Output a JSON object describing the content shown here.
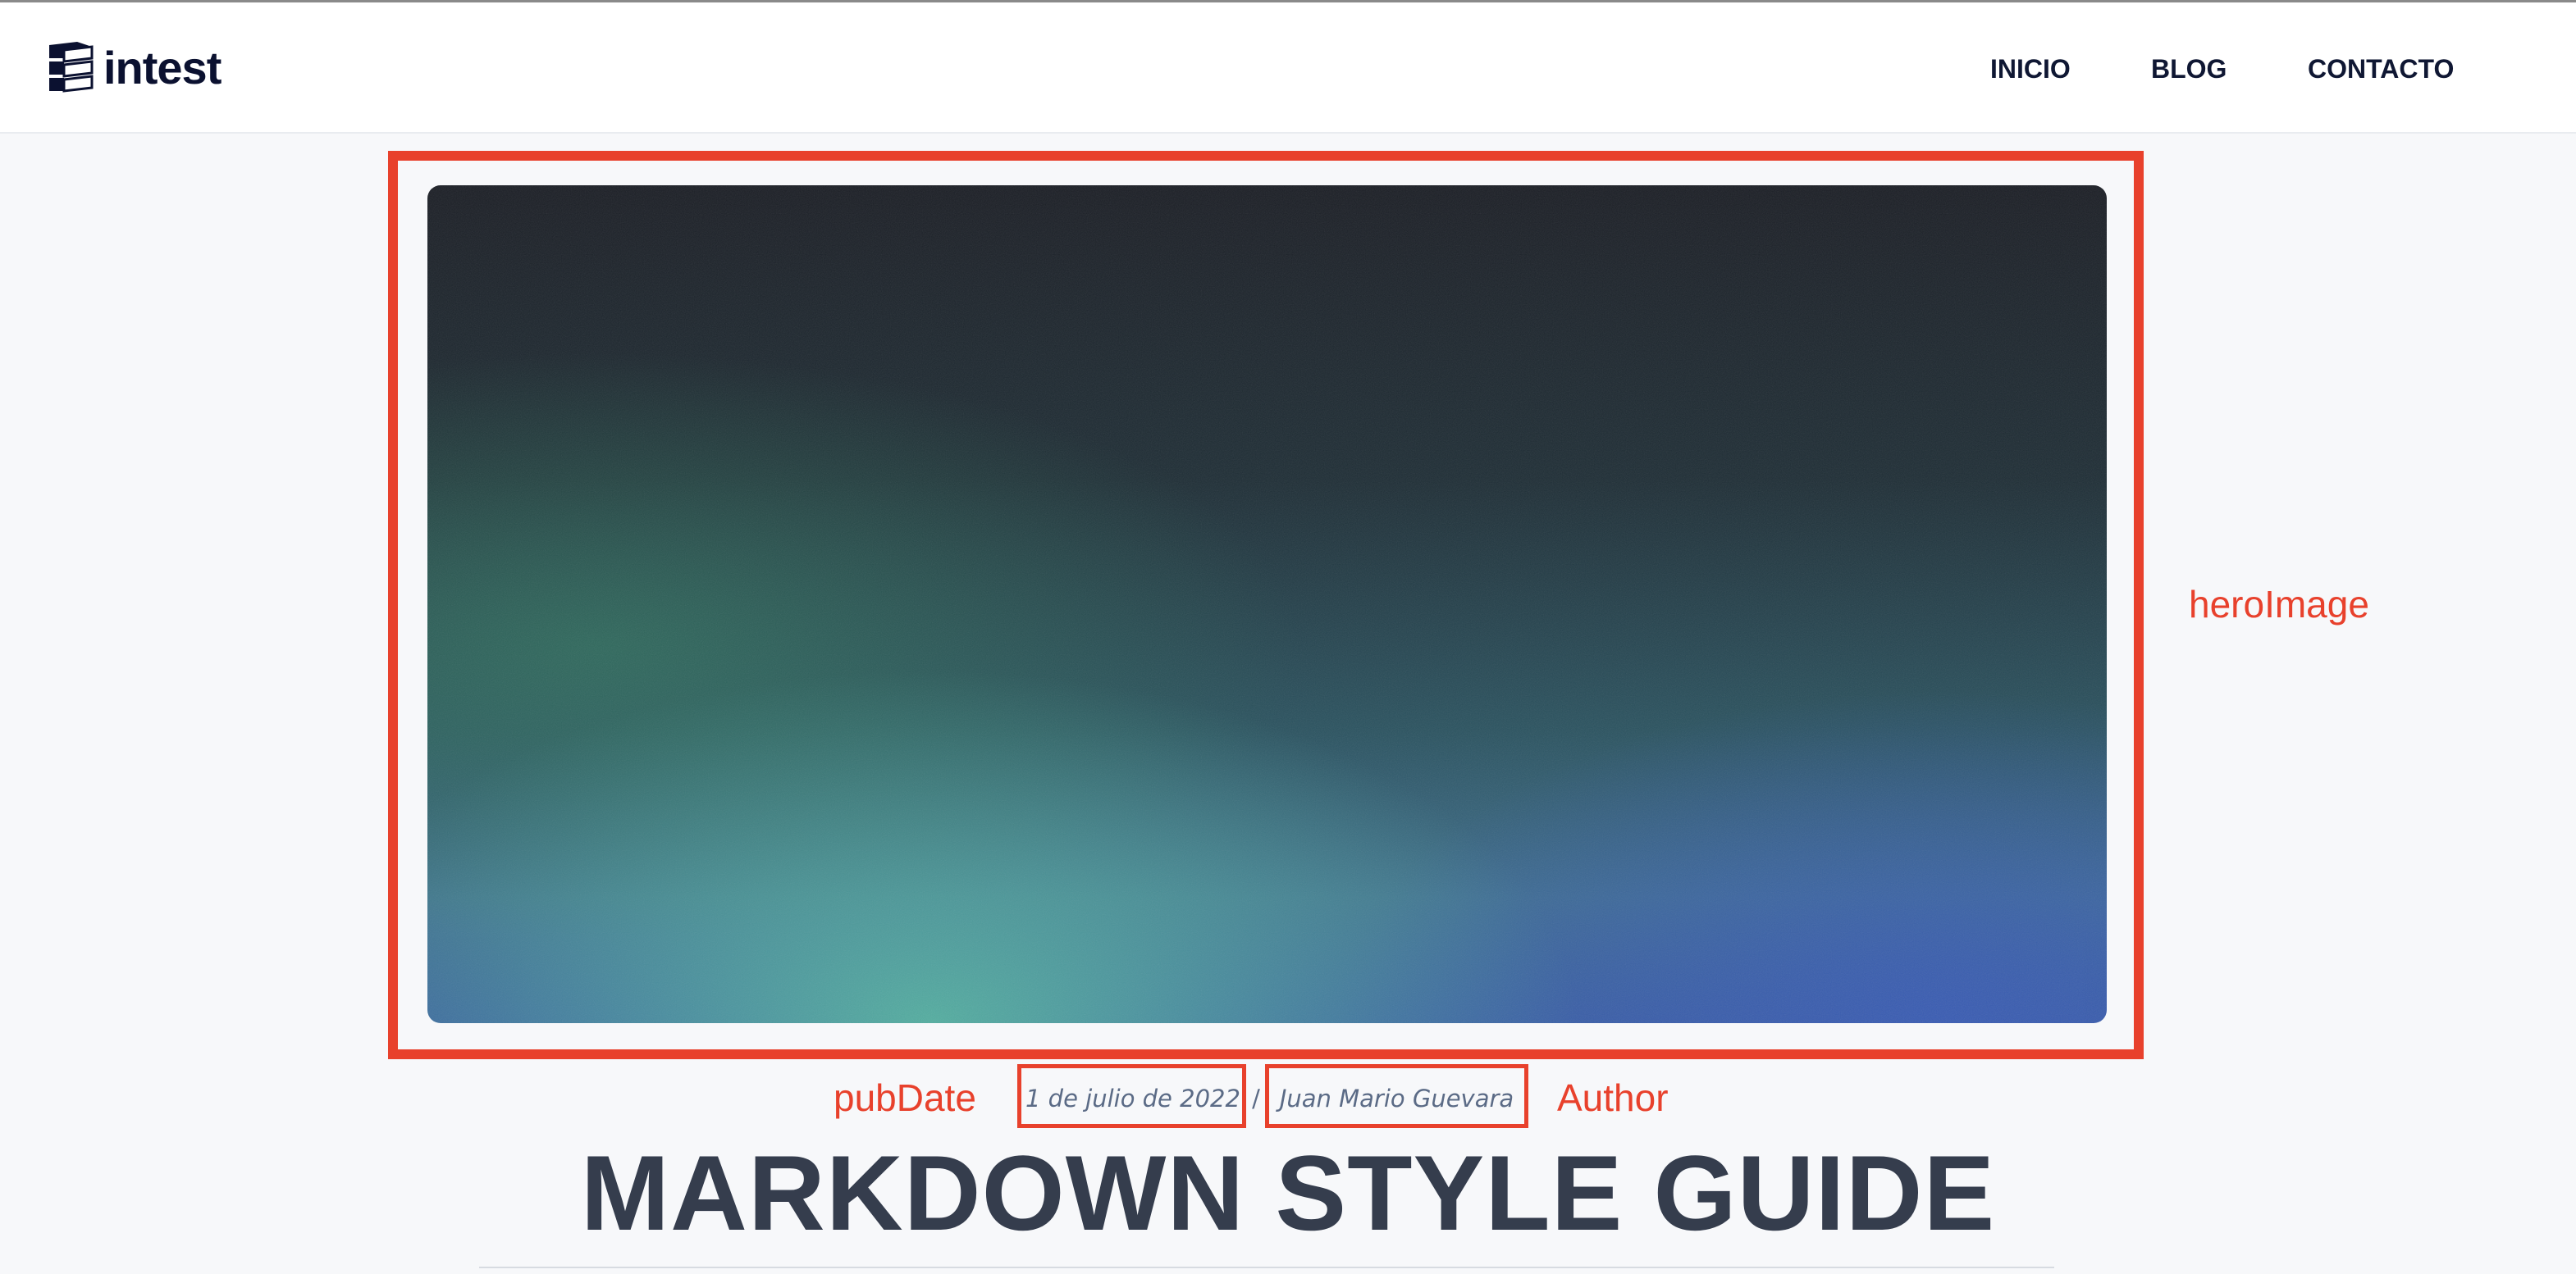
{
  "header": {
    "logo_text": "intest",
    "logo_icon": "stacked-books-icon",
    "nav": [
      {
        "label": "INICIO"
      },
      {
        "label": "BLOG"
      },
      {
        "label": "CONTACTO"
      }
    ]
  },
  "annotations": {
    "hero": "heroImage",
    "pubdate": "pubDate",
    "author": "Author",
    "color": "#e8412c"
  },
  "post": {
    "pub_date": "1 de julio de 2022",
    "separator": "/",
    "author": "Juan Mario Guevara",
    "title": "MARKDOWN STYLE GUIDE"
  },
  "colors": {
    "page_background": "#f7f8fa",
    "nav_text": "#0f1733",
    "title_text": "#353d4d",
    "meta_text": "#5b6b86",
    "annotation": "#e8412c"
  }
}
